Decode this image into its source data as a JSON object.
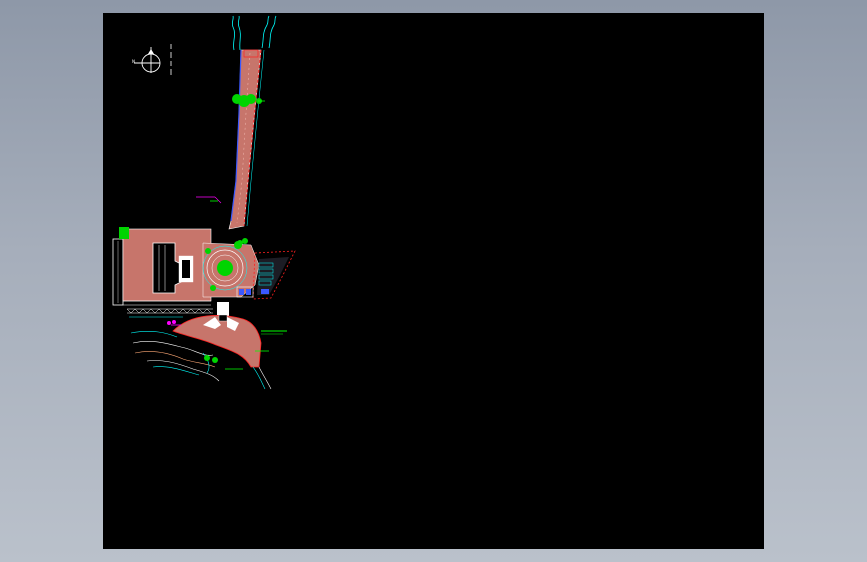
{
  "viewer": {
    "background_color": "#000000",
    "frame_color": "#a3acb9"
  },
  "drawing": {
    "north_arrow": {
      "letter": "N"
    },
    "colors": {
      "paving": "#c7756b",
      "vegetation": "#00d400",
      "annotation": "#00ff00",
      "annotation_alt": "#ff00ff",
      "boundary": "#00ffff",
      "edge": "#ff2020",
      "outline": "#ffffff",
      "blue_detail": "#3a58ff"
    }
  }
}
